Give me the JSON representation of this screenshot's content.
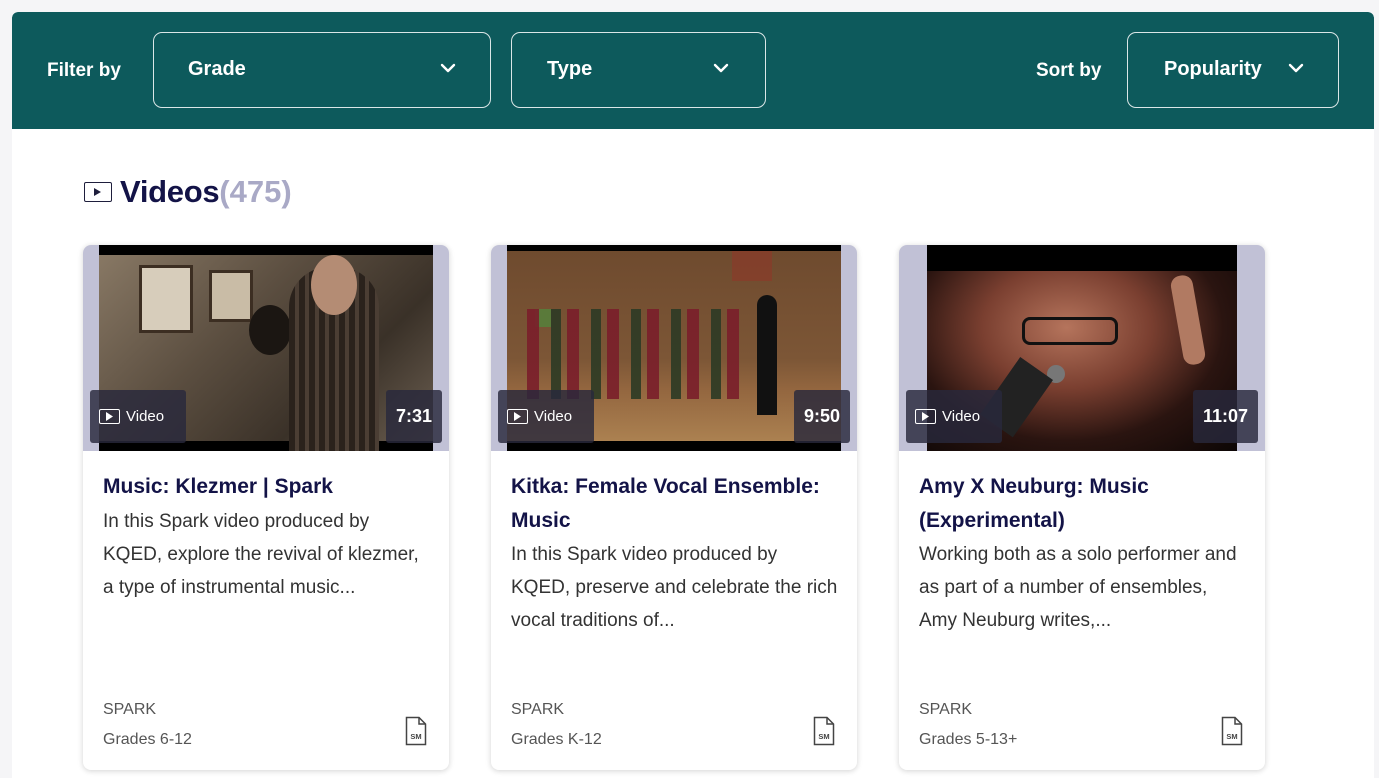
{
  "filter_bar": {
    "filter_label": "Filter by",
    "grade_label": "Grade",
    "type_label": "Type",
    "sort_label": "Sort by",
    "sort_value": "Popularity"
  },
  "section": {
    "title": "Videos",
    "count": "(475)",
    "icon": "video-play-icon"
  },
  "colors": {
    "bar": "#0d5a5c",
    "title": "#131347",
    "count": "#a9a9c6"
  },
  "cards": [
    {
      "badge": "Video",
      "duration": "7:31",
      "title": "Music: Klezmer | Spark",
      "description": "In this Spark video produced by KQED, explore the revival of klezmer, a type of instrumental music...",
      "source": "SPARK",
      "grades": "Grades 6-12",
      "file_icon": "sm-file-icon"
    },
    {
      "badge": "Video",
      "duration": "9:50",
      "title": "Kitka: Female Vocal Ensemble: Music",
      "description": "In this Spark video produced by KQED, preserve and celebrate the rich vocal traditions of...",
      "source": "SPARK",
      "grades": "Grades K-12",
      "file_icon": "sm-file-icon"
    },
    {
      "badge": "Video",
      "duration": "11:07",
      "title": "Amy X Neuburg: Music (Experimental)",
      "description": "Working both as a solo performer and as part of a number of ensembles, Amy Neuburg writes,...",
      "source": "SPARK",
      "grades": "Grades 5-13+",
      "file_icon": "sm-file-icon"
    }
  ]
}
